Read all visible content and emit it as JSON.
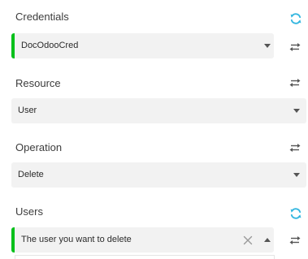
{
  "fields": {
    "credentials": {
      "label": "Credentials",
      "value": "DocOdooCred"
    },
    "resource": {
      "label": "Resource",
      "value": "User"
    },
    "operation": {
      "label": "Operation",
      "value": "Delete"
    },
    "users": {
      "label": "Users",
      "value": "The user you want to delete"
    }
  },
  "icons": {
    "refresh": "refresh-icon",
    "expression_toggle": "swap-arrows-icon",
    "caret_down": "chevron-down-icon",
    "caret_up": "chevron-up-icon",
    "clear": "close-icon"
  },
  "colors": {
    "valid_bar": "#00c01a",
    "refresh_icon": "#36b7e0",
    "field_background": "#f2f2f2"
  }
}
